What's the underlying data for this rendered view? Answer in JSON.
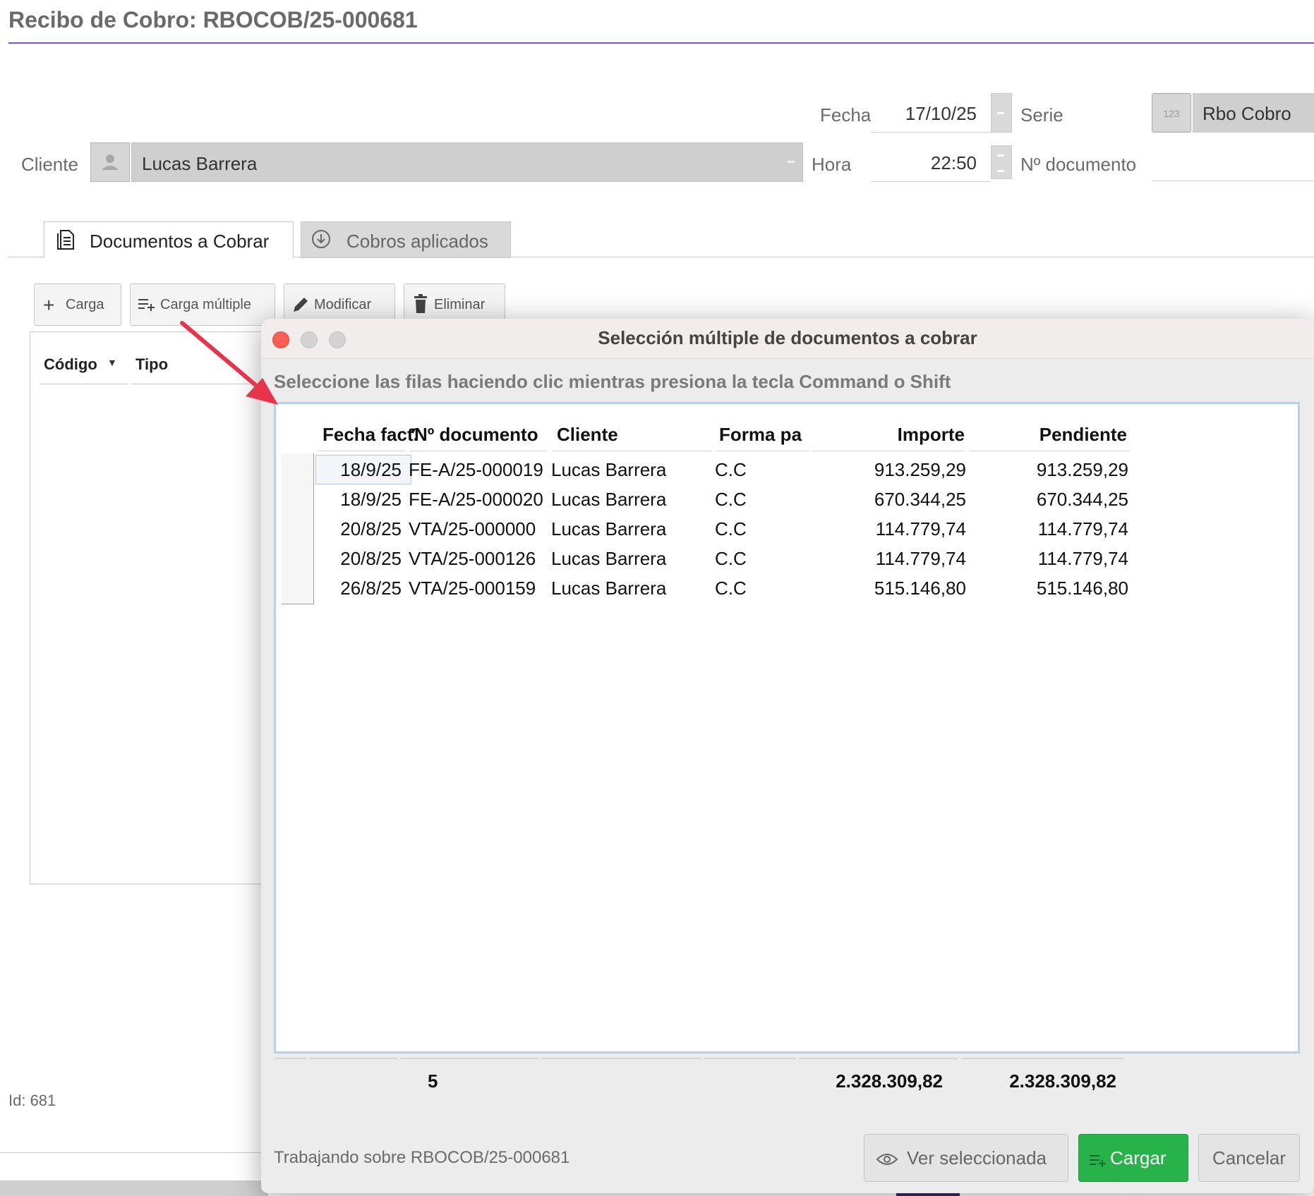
{
  "page": {
    "title": "Recibo de Cobro: RBOCOB/25-000681"
  },
  "form": {
    "fecha_label": "Fecha",
    "fecha_value": "17/10/25",
    "hora_label": "Hora",
    "hora_value": "22:50",
    "serie_label": "Serie",
    "serie_icon_text": "123",
    "serie_value": "Rbo Cobro",
    "ndoc_label": "Nº documento",
    "ndoc_value": "",
    "cliente_label": "Cliente",
    "cliente_value": "Lucas Barrera"
  },
  "tabs": [
    {
      "label": "Documentos a Cobrar",
      "icon": "document-icon",
      "active": true
    },
    {
      "label": "Cobros aplicados",
      "icon": "download-circle-icon",
      "active": false
    }
  ],
  "toolbar": {
    "carga": "Carga",
    "carga_multiple": "Carga múltiple",
    "modificar": "Modificar",
    "eliminar": "Eliminar"
  },
  "bg_table": {
    "columns": [
      "Código",
      "Tipo"
    ]
  },
  "footer": {
    "record_id": "Id: 681"
  },
  "dialog": {
    "title": "Selección múltiple de documentos a cobrar",
    "instructions": "Seleccione las filas haciendo clic mientras presiona la tecla Command o Shift",
    "columns": [
      "Fecha fact.",
      "Nº documento",
      "Cliente",
      "Forma pago",
      "Importe",
      "Pendiente"
    ],
    "rows": [
      {
        "fecha": "18/9/25",
        "ndoc": "FE-A/25-000019",
        "cliente": "Lucas Barrera",
        "forma": "C.C",
        "importe": "913.259,29",
        "pendiente": "913.259,29"
      },
      {
        "fecha": "18/9/25",
        "ndoc": "FE-A/25-000020",
        "cliente": "Lucas Barrera",
        "forma": "C.C",
        "importe": "670.344,25",
        "pendiente": "670.344,25"
      },
      {
        "fecha": "20/8/25",
        "ndoc": "VTA/25-000000",
        "cliente": "Lucas Barrera",
        "forma": "C.C",
        "importe": "114.779,74",
        "pendiente": "114.779,74"
      },
      {
        "fecha": "20/8/25",
        "ndoc": "VTA/25-000126",
        "cliente": "Lucas Barrera",
        "forma": "C.C",
        "importe": "114.779,74",
        "pendiente": "114.779,74"
      },
      {
        "fecha": "26/8/25",
        "ndoc": "VTA/25-000159",
        "cliente": "Lucas Barrera",
        "forma": "C.C",
        "importe": "515.146,80",
        "pendiente": "515.146,80"
      }
    ],
    "totals": {
      "count": "5",
      "importe": "2.328.309,82",
      "pendiente": "2.328.309,82"
    },
    "status": "Trabajando sobre RBOCOB/25-000681",
    "buttons": {
      "ver": "Ver seleccionada",
      "cargar": "Cargar",
      "cancelar": "Cancelar"
    }
  },
  "colors": {
    "accent": "#8a4bd0",
    "primary_button": "#27b34a",
    "close_button": "#ff5f57",
    "arrow": "#e8344a"
  }
}
